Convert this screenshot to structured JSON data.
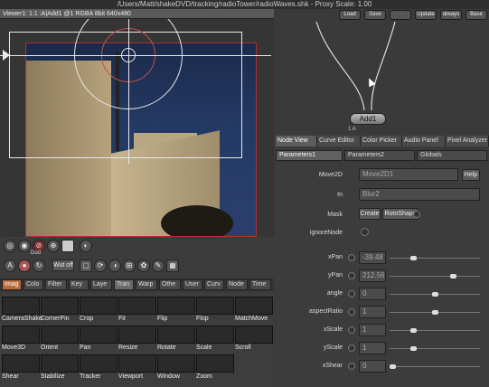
{
  "window_title": "/Users/Matt/shakeDVD/tracking/radioTower/radioWaves.shk - Proxy Scale: 1.00",
  "viewer": {
    "header": "Viewer1: 1:1 :A|Add1 @1 RGBA 8bit 640x480"
  },
  "toolbar_right": {
    "load": "Load",
    "save": "Save",
    "update": "Update",
    "always": "always",
    "base": "Base"
  },
  "viewer_toolbar": {
    "dod_label": "Dod",
    "wut_off": "Wut off"
  },
  "node_view": {
    "node_label": "Add1",
    "node_tag": "1 A"
  },
  "sub_tabs": [
    "Node View",
    "Curve Editor",
    "Color Picker",
    "Audio Panel",
    "Pixel Analyzer"
  ],
  "param_tabs": [
    "Parameters1",
    "Parameters2",
    "Globals"
  ],
  "bottom_tabs": [
    "Imag",
    "Colo",
    "Filter",
    "Key",
    "Laye",
    "Tran",
    "Warp",
    "Othe",
    "User",
    "Curv",
    "Node",
    "Time"
  ],
  "nodes": [
    [
      "CameraShake",
      "CornerPin",
      "Crop",
      "Fit",
      "Flip",
      "Flop",
      "MatchMove"
    ],
    [
      "Move3D",
      "Orient",
      "Pan",
      "Resize",
      "Rotate",
      "Scale",
      "Scroll"
    ],
    [
      "Shear",
      "Stabilize",
      "Tracker",
      "Viewport",
      "Window",
      "Zoom"
    ]
  ],
  "params": {
    "node_name_label": "Move2D",
    "node_name_value": "Move2D1",
    "help": "Help",
    "in_label": "In",
    "in_value": "Blur2",
    "mask_label": "Mask",
    "create": "Create",
    "rotoshape": "RotoShape",
    "ignore_label": "ignoreNode",
    "rows": [
      {
        "label": "xPan",
        "value": "-39.48",
        "level": 0.25
      },
      {
        "label": "yPan",
        "value": "212.56",
        "level": 0.72
      },
      {
        "label": "angle",
        "value": "0",
        "level": 0.5
      },
      {
        "label": "aspectRatio",
        "value": "1",
        "level": 0.5
      },
      {
        "label": "xScale",
        "value": "1",
        "level": 0.25
      },
      {
        "label": "yScale",
        "value": "1",
        "level": 0.25
      },
      {
        "label": "xShear",
        "value": "0",
        "level": 0.0
      }
    ]
  },
  "colors": {
    "accent": "#b86a3a",
    "ring": "#e8e8e8",
    "roi": "#b03030"
  }
}
